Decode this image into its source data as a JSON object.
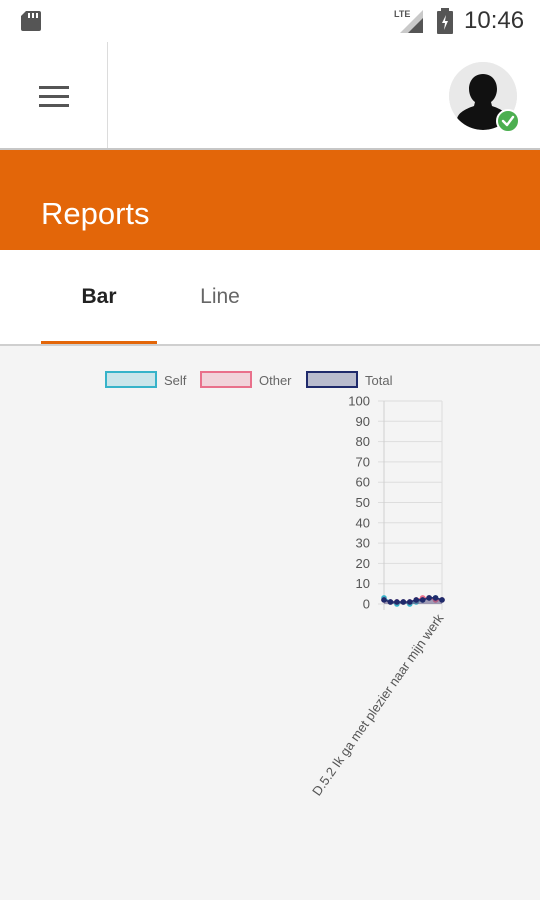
{
  "status_bar": {
    "time": "10:46",
    "network": "LTE",
    "icons": [
      "sd-card-icon",
      "signal-icon",
      "battery-icon"
    ]
  },
  "app_bar": {
    "menu_icon": "hamburger-menu-icon",
    "avatar_icon": "user-silhouette-icon",
    "status_badge_icon": "check-icon"
  },
  "header": {
    "title": "Reports"
  },
  "tabs": [
    {
      "label": "Bar",
      "active": true
    },
    {
      "label": "Line",
      "active": false
    }
  ],
  "colors": {
    "accent": "#e36609",
    "self": "#36b3c9",
    "other": "#e9708b",
    "total": "#1f2a6b",
    "badge": "#4caf50"
  },
  "chart_data": {
    "type": "line",
    "legend": [
      "Self",
      "Other",
      "Total"
    ],
    "legend_position": "top",
    "x_labels": [
      "D.5.2 Ik ga met plezier naar mijn werk"
    ],
    "y_ticks": [
      "100",
      "90",
      "80",
      "70",
      "60",
      "50",
      "40",
      "30",
      "20",
      "10",
      "0"
    ],
    "ylim": [
      0,
      100
    ],
    "grid": true,
    "series": [
      {
        "name": "Self",
        "values": [
          3,
          1,
          0,
          1,
          0,
          1,
          2,
          3,
          3,
          2
        ]
      },
      {
        "name": "Other",
        "values": [
          2,
          1,
          1,
          1,
          1,
          2,
          3,
          3,
          2,
          2
        ]
      },
      {
        "name": "Total",
        "values": [
          2,
          1,
          1,
          1,
          1,
          2,
          2,
          3,
          3,
          2
        ]
      }
    ]
  }
}
